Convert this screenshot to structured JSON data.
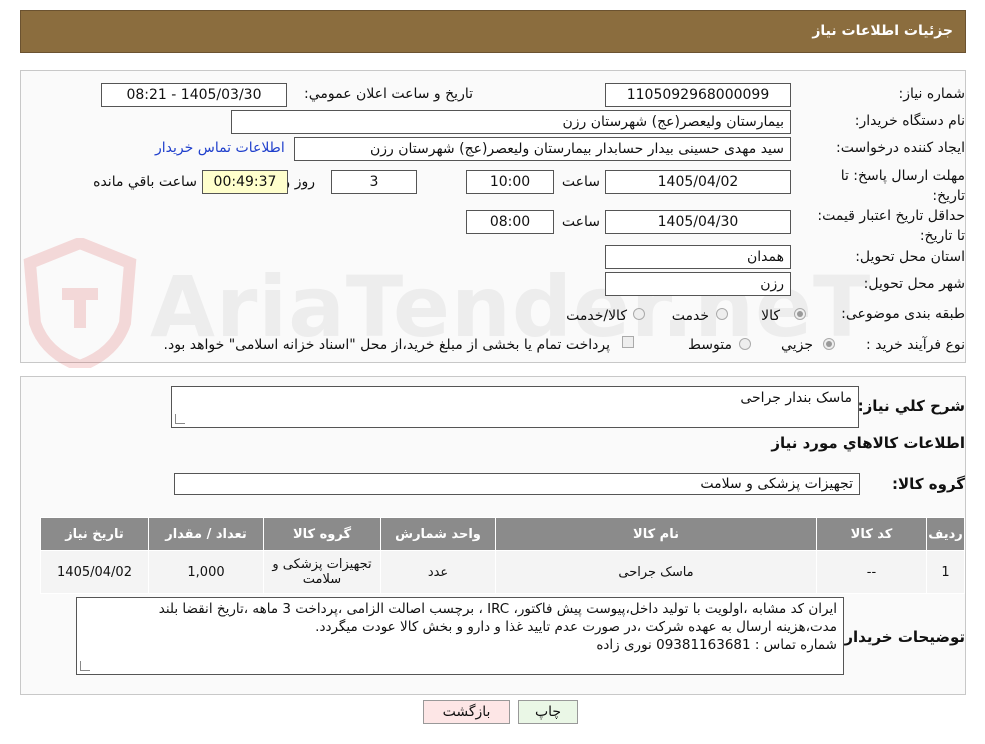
{
  "header": {
    "title": "جزئيات اطلاعات نياز"
  },
  "form": {
    "need_number_label": "شماره نياز:",
    "need_number": "1105092968000099",
    "announce_label": "تاريخ و ساعت اعلان عمومي:",
    "announce_value": "1405/03/30 - 08:21",
    "buyer_org_label": "نام دستگاه خريدار:",
    "buyer_org": "بیمارستان ولیعصر(عج) شهرستان رزن",
    "creator_label": "ايجاد کننده درخواست:",
    "creator": "سید مهدی حسینی بیدار حسابدار بیمارستان ولیعصر(عج) شهرستان رزن",
    "contact_link": "اطلاعات تماس خريدار",
    "deadline_label": "مهلت ارسال پاسخ: تا تاريخ:",
    "deadline_date": "1405/04/02",
    "time_label": "ساعت",
    "deadline_time": "10:00",
    "days_value": "3",
    "days_label": "روز و",
    "remaining_time": "00:49:37",
    "remaining_label": "ساعت باقي مانده",
    "validity_label": "حداقل تاريخ اعتبار قيمت: تا تاريخ:",
    "validity_date": "1405/04/30",
    "validity_time": "08:00",
    "province_label": "استان محل تحويل:",
    "province": "همدان",
    "city_label": "شهر محل تحويل:",
    "city": "رزن",
    "category_label": "طبقه بندی موضوعی:",
    "category_options": [
      "کالا",
      "خدمت",
      "کالا/خدمت"
    ],
    "process_label": "نوع فرآيند خريد :",
    "process_options": [
      "جزيي",
      "متوسط"
    ],
    "treasury_text": "پرداخت تمام يا بخشی از مبلغ خريد،از محل \"اسناد خزانه اسلامی\" خواهد بود."
  },
  "summary": {
    "desc_label": "شرح كلي نياز:",
    "desc_value": "ماسک بندار جراحی",
    "goods_info_title": "اطلاعات كالاهاي مورد نياز",
    "group_label": "گروه كالا:",
    "group_value": "تجهیزات پزشکی و سلامت"
  },
  "table": {
    "headers": [
      "رديف",
      "كد كالا",
      "نام كالا",
      "واحد شمارش",
      "گروه كالا",
      "تعداد / مقدار",
      "تاريخ نياز"
    ],
    "rows": [
      [
        "1",
        "--",
        "ماسک جراحی",
        "عدد",
        "تجهیزات پزشکی و سلامت",
        "1,000",
        "1405/04/02"
      ]
    ]
  },
  "notes": {
    "label": "توضيحات خريدار:",
    "line1": "ایران کد مشابه ،اولویت با تولید داخل،پیوست پیش فاکتور، IRC ، برچسب اصالت الزامی ،پرداخت 3 ماهه ،تاریخ انقضا بلند",
    "line2": "مدت،هزینه ارسال به عهده شرکت ،در صورت عدم تایید غذا و دارو و بخش کالا عودت میگردد.",
    "line3": "شماره تماس : 09381163681 نوری زاده"
  },
  "buttons": {
    "print": "چاپ",
    "back": "بازگشت"
  },
  "watermark": {
    "text": "AriaTender.neT"
  },
  "colors": {
    "header_bg": "#8b6d3e",
    "table_header_bg": "#8b8b8b",
    "remaining_bg": "#ffffcc",
    "link": "#1f3fcc"
  }
}
